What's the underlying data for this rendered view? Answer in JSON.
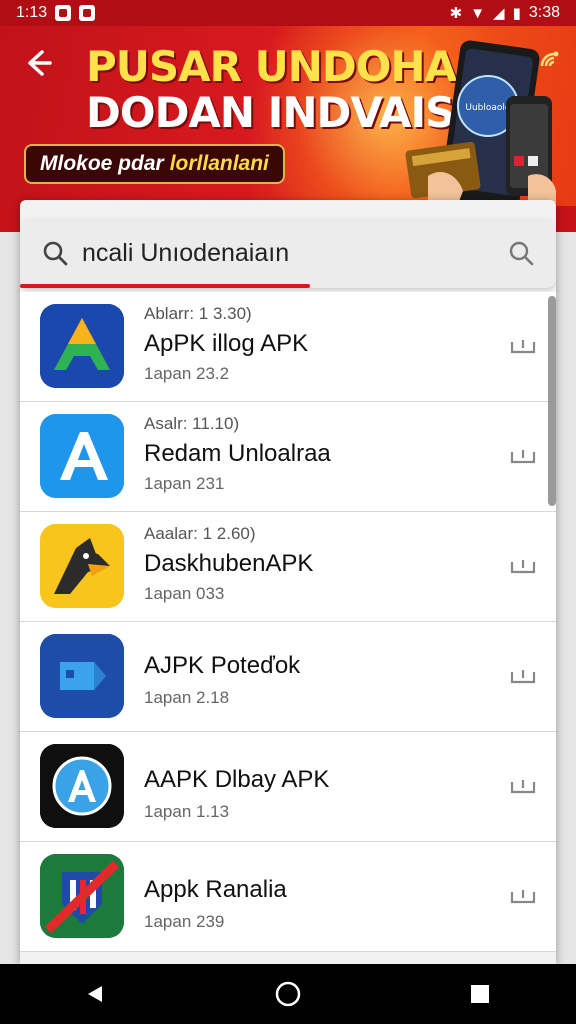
{
  "status_bar": {
    "time": "1:13",
    "right_time": "3:38"
  },
  "banner": {
    "title_line1": "PUSAR UNDOHAN",
    "title_line2": "DODAN INDVAISIA",
    "pill_text_1": "Mlokoe pdar",
    "pill_text_2": "lorllanlani",
    "phone_text": "Uubloaolg"
  },
  "search": {
    "query": "ncali Unıodenaiaın"
  },
  "apps": [
    {
      "meta": "Ablarr: 1 3.30)",
      "title": "ApPK illog APK",
      "sub": "1apan 23.2",
      "icon": "triangle-logo-icon"
    },
    {
      "meta": "Asalr: 11.10)",
      "title": "Redam Unloalraa",
      "sub": "1apan 231",
      "icon": "a-logo-icon"
    },
    {
      "meta": "Aaalar: 1 2.60)",
      "title": "DaskhubenAPK",
      "sub": "1apan 033",
      "icon": "bird-logo-icon"
    },
    {
      "meta": "",
      "title": "AJPK Poteďok",
      "sub": "1apan 2.18",
      "icon": "tag-logo-icon"
    },
    {
      "meta": "",
      "title": "AAPK Dlbay APK",
      "sub": "1apan 1.13",
      "icon": "app-store-logo-icon"
    },
    {
      "meta": "",
      "title": "Appk Ranalia",
      "sub": "1apan 239",
      "icon": "crest-logo-icon"
    }
  ],
  "colors": {
    "brand_red": "#c8121a",
    "accent_yellow": "#ffe14a"
  }
}
